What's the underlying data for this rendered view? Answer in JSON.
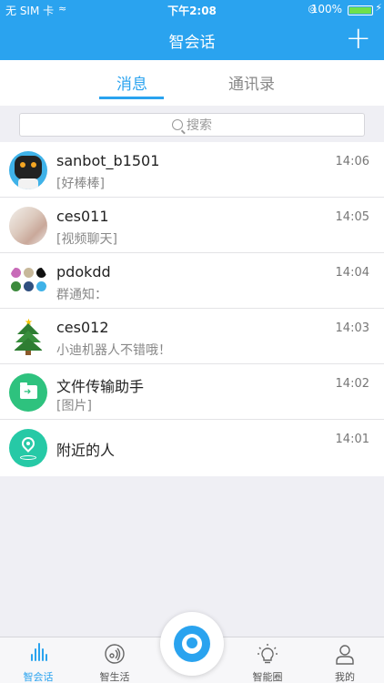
{
  "status_bar": {
    "carrier": "无 SIM 卡",
    "time": "下午2:08",
    "battery_percent": "100%"
  },
  "nav": {
    "title": "智会话"
  },
  "tabs": [
    {
      "label": "消息",
      "active": true
    },
    {
      "label": "通讯录",
      "active": false
    }
  ],
  "search": {
    "placeholder": "搜索"
  },
  "conversations": [
    {
      "name": "sanbot_b1501",
      "preview": "[好棒棒]",
      "time": "14:06",
      "avatar": "robot-avatar"
    },
    {
      "name": "ces011",
      "preview": "[视频聊天]",
      "time": "14:05",
      "avatar": "photo-avatar"
    },
    {
      "name": "pdokdd",
      "preview": "群通知：",
      "time": "14:04",
      "avatar": "group-avatar"
    },
    {
      "name": "ces012",
      "preview": "小迪机器人不错哦！",
      "time": "14:03",
      "avatar": "christmas-tree-avatar"
    },
    {
      "name": "文件传输助手",
      "preview": "[图片]",
      "time": "14:02",
      "avatar": "folder-icon"
    },
    {
      "name": "附近的人",
      "preview": "",
      "time": "14:01",
      "avatar": "location-pin-icon"
    }
  ],
  "tab_bar": [
    {
      "label": "智会话",
      "icon": "sound-wave-icon",
      "active": true
    },
    {
      "label": "智生活",
      "icon": "robot-ear-icon",
      "active": false
    },
    {
      "label": "",
      "icon": "camera-eye-icon",
      "active": false
    },
    {
      "label": "智能圈",
      "icon": "lightbulb-icon",
      "active": false
    },
    {
      "label": "我的",
      "icon": "person-icon",
      "active": false
    }
  ],
  "colors": {
    "primary": "#2aa3ef",
    "background": "#efeff4"
  }
}
